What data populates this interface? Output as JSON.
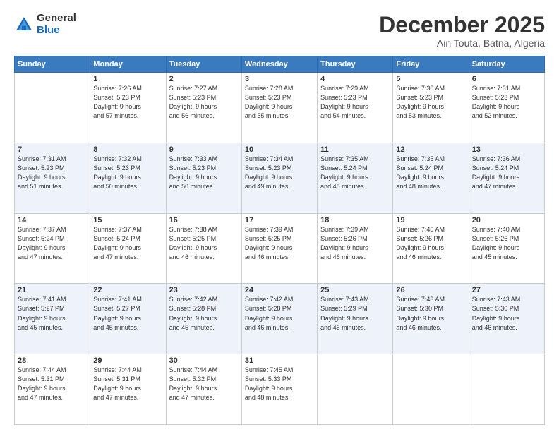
{
  "logo": {
    "general": "General",
    "blue": "Blue"
  },
  "header": {
    "month": "December 2025",
    "location": "Ain Touta, Batna, Algeria"
  },
  "weekdays": [
    "Sunday",
    "Monday",
    "Tuesday",
    "Wednesday",
    "Thursday",
    "Friday",
    "Saturday"
  ],
  "weeks": [
    [
      {
        "day": "",
        "info": ""
      },
      {
        "day": "1",
        "info": "Sunrise: 7:26 AM\nSunset: 5:23 PM\nDaylight: 9 hours\nand 57 minutes."
      },
      {
        "day": "2",
        "info": "Sunrise: 7:27 AM\nSunset: 5:23 PM\nDaylight: 9 hours\nand 56 minutes."
      },
      {
        "day": "3",
        "info": "Sunrise: 7:28 AM\nSunset: 5:23 PM\nDaylight: 9 hours\nand 55 minutes."
      },
      {
        "day": "4",
        "info": "Sunrise: 7:29 AM\nSunset: 5:23 PM\nDaylight: 9 hours\nand 54 minutes."
      },
      {
        "day": "5",
        "info": "Sunrise: 7:30 AM\nSunset: 5:23 PM\nDaylight: 9 hours\nand 53 minutes."
      },
      {
        "day": "6",
        "info": "Sunrise: 7:31 AM\nSunset: 5:23 PM\nDaylight: 9 hours\nand 52 minutes."
      }
    ],
    [
      {
        "day": "7",
        "info": "Sunrise: 7:31 AM\nSunset: 5:23 PM\nDaylight: 9 hours\nand 51 minutes."
      },
      {
        "day": "8",
        "info": "Sunrise: 7:32 AM\nSunset: 5:23 PM\nDaylight: 9 hours\nand 50 minutes."
      },
      {
        "day": "9",
        "info": "Sunrise: 7:33 AM\nSunset: 5:23 PM\nDaylight: 9 hours\nand 50 minutes."
      },
      {
        "day": "10",
        "info": "Sunrise: 7:34 AM\nSunset: 5:23 PM\nDaylight: 9 hours\nand 49 minutes."
      },
      {
        "day": "11",
        "info": "Sunrise: 7:35 AM\nSunset: 5:24 PM\nDaylight: 9 hours\nand 48 minutes."
      },
      {
        "day": "12",
        "info": "Sunrise: 7:35 AM\nSunset: 5:24 PM\nDaylight: 9 hours\nand 48 minutes."
      },
      {
        "day": "13",
        "info": "Sunrise: 7:36 AM\nSunset: 5:24 PM\nDaylight: 9 hours\nand 47 minutes."
      }
    ],
    [
      {
        "day": "14",
        "info": "Sunrise: 7:37 AM\nSunset: 5:24 PM\nDaylight: 9 hours\nand 47 minutes."
      },
      {
        "day": "15",
        "info": "Sunrise: 7:37 AM\nSunset: 5:24 PM\nDaylight: 9 hours\nand 47 minutes."
      },
      {
        "day": "16",
        "info": "Sunrise: 7:38 AM\nSunset: 5:25 PM\nDaylight: 9 hours\nand 46 minutes."
      },
      {
        "day": "17",
        "info": "Sunrise: 7:39 AM\nSunset: 5:25 PM\nDaylight: 9 hours\nand 46 minutes."
      },
      {
        "day": "18",
        "info": "Sunrise: 7:39 AM\nSunset: 5:26 PM\nDaylight: 9 hours\nand 46 minutes."
      },
      {
        "day": "19",
        "info": "Sunrise: 7:40 AM\nSunset: 5:26 PM\nDaylight: 9 hours\nand 46 minutes."
      },
      {
        "day": "20",
        "info": "Sunrise: 7:40 AM\nSunset: 5:26 PM\nDaylight: 9 hours\nand 45 minutes."
      }
    ],
    [
      {
        "day": "21",
        "info": "Sunrise: 7:41 AM\nSunset: 5:27 PM\nDaylight: 9 hours\nand 45 minutes."
      },
      {
        "day": "22",
        "info": "Sunrise: 7:41 AM\nSunset: 5:27 PM\nDaylight: 9 hours\nand 45 minutes."
      },
      {
        "day": "23",
        "info": "Sunrise: 7:42 AM\nSunset: 5:28 PM\nDaylight: 9 hours\nand 45 minutes."
      },
      {
        "day": "24",
        "info": "Sunrise: 7:42 AM\nSunset: 5:28 PM\nDaylight: 9 hours\nand 46 minutes."
      },
      {
        "day": "25",
        "info": "Sunrise: 7:43 AM\nSunset: 5:29 PM\nDaylight: 9 hours\nand 46 minutes."
      },
      {
        "day": "26",
        "info": "Sunrise: 7:43 AM\nSunset: 5:30 PM\nDaylight: 9 hours\nand 46 minutes."
      },
      {
        "day": "27",
        "info": "Sunrise: 7:43 AM\nSunset: 5:30 PM\nDaylight: 9 hours\nand 46 minutes."
      }
    ],
    [
      {
        "day": "28",
        "info": "Sunrise: 7:44 AM\nSunset: 5:31 PM\nDaylight: 9 hours\nand 47 minutes."
      },
      {
        "day": "29",
        "info": "Sunrise: 7:44 AM\nSunset: 5:31 PM\nDaylight: 9 hours\nand 47 minutes."
      },
      {
        "day": "30",
        "info": "Sunrise: 7:44 AM\nSunset: 5:32 PM\nDaylight: 9 hours\nand 47 minutes."
      },
      {
        "day": "31",
        "info": "Sunrise: 7:45 AM\nSunset: 5:33 PM\nDaylight: 9 hours\nand 48 minutes."
      },
      {
        "day": "",
        "info": ""
      },
      {
        "day": "",
        "info": ""
      },
      {
        "day": "",
        "info": ""
      }
    ]
  ]
}
